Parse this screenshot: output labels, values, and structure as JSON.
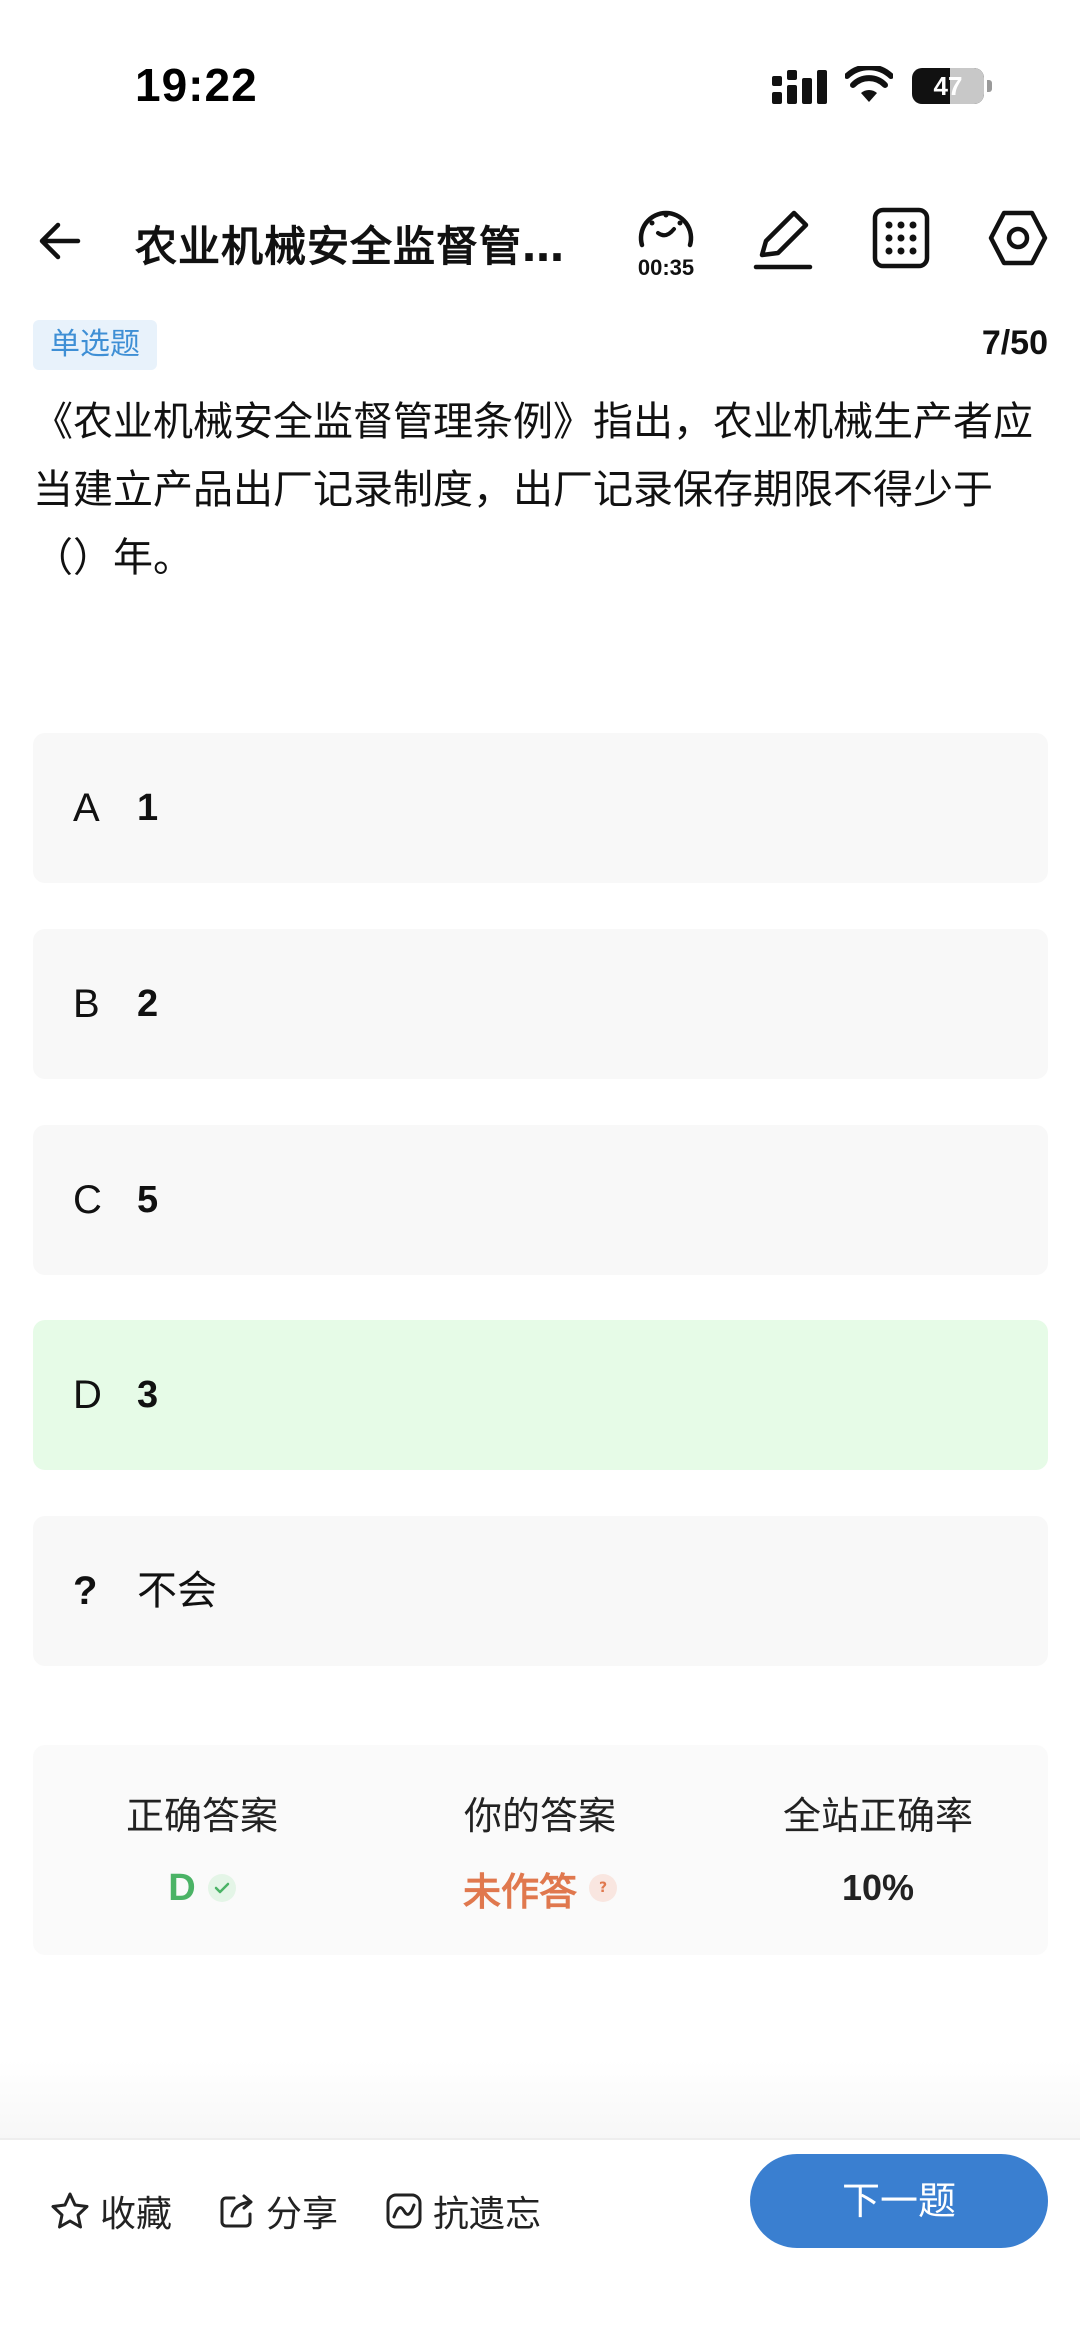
{
  "status_bar": {
    "time": "19:22",
    "battery": "47",
    "icons": [
      "signal-icon",
      "wifi-icon",
      "battery-icon"
    ]
  },
  "header": {
    "title": "农业机械安全监督管…",
    "timer": "00:35",
    "icons": [
      "back-arrow-icon",
      "timer-icon",
      "edit-icon",
      "grid-icon",
      "settings-icon"
    ]
  },
  "question": {
    "type": "单选题",
    "progress": "7/50",
    "text": "《农业机械安全监督管理条例》指出，农业机械生产者应当建立产品出厂记录制度，出厂记录保存期限不得少于（）年。"
  },
  "options": [
    {
      "letter": "A",
      "text": "1",
      "state": "normal"
    },
    {
      "letter": "B",
      "text": "2",
      "state": "normal"
    },
    {
      "letter": "C",
      "text": "5",
      "state": "normal"
    },
    {
      "letter": "D",
      "text": "3",
      "state": "correct"
    },
    {
      "letter": "?",
      "text": "不会",
      "state": "normal"
    }
  ],
  "result": {
    "correct_label": "正确答案",
    "correct_value": "D",
    "yours_label": "你的答案",
    "yours_value": "未作答",
    "yours_hint": "?",
    "rate_label": "全站正确率",
    "rate_value": "10%"
  },
  "bottom_bar": {
    "favorite": "收藏",
    "share": "分享",
    "anti_forget": "抗遗忘",
    "next": "下一题"
  },
  "colors": {
    "accent": "#3a7fd0",
    "correct": "#4bb366",
    "unanswered": "#e0784e",
    "correct_bg": "#e6fbe7"
  }
}
